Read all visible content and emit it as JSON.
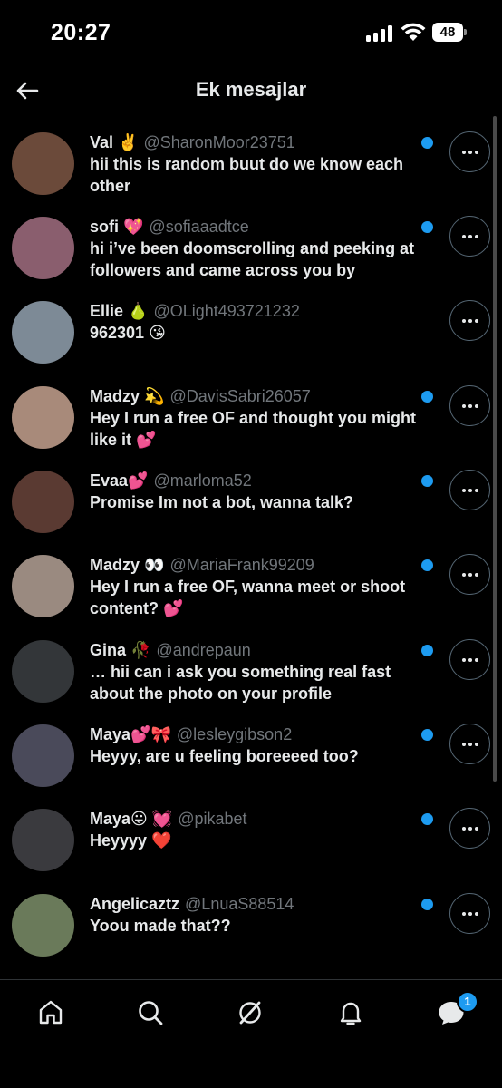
{
  "status_bar": {
    "time": "20:27",
    "battery": "48"
  },
  "header": {
    "title": "Ek mesajlar"
  },
  "conversations": [
    {
      "name": "Val ✌️",
      "handle": "@SharonMoor23751",
      "preview": "hii this is random buut do we know each other",
      "unread": true,
      "avatar_color": "#6b4a3a"
    },
    {
      "name": "sofi 💖",
      "handle": "@sofiaaadtce",
      "preview": "hi i’ve been doomscrolling and peeking at followers and came across you by",
      "unread": true,
      "avatar_color": "#8a5e6e"
    },
    {
      "name": "Ellie 🍐",
      "handle": "@OLight493721232",
      "preview": "962301 😘",
      "unread": false,
      "avatar_color": "#7d8a96"
    },
    {
      "name": "Madzy 💫",
      "handle": "@DavisSabri26057",
      "preview": "Hey I run a free OF and thought you might like it 💕",
      "unread": true,
      "avatar_color": "#a88a7a"
    },
    {
      "name": "Evaa💕",
      "handle": "@marloma52",
      "preview": "Promise Im not a bot, wanna talk?",
      "unread": true,
      "avatar_color": "#5a3a32"
    },
    {
      "name": "Madzy 👀",
      "handle": "@MariaFrank99209",
      "preview": "Hey I run a free OF, wanna meet or shoot content? 💕",
      "unread": true,
      "avatar_color": "#9a8a80"
    },
    {
      "name": "Gina 🥀",
      "handle": "@andrepaun",
      "preview": "… hii can i ask you something real fast about the photo on your profile",
      "unread": true,
      "avatar_color": "#333639"
    },
    {
      "name": "Maya💕🎀",
      "handle": "@lesleygibson2",
      "preview": "Heyyy, are u feeling boreeeed too?",
      "unread": true,
      "avatar_color": "#4a4a5a"
    },
    {
      "name": "Maya😛 💓",
      "handle": "@pikabet",
      "preview": "Heyyyy ❤️",
      "unread": true,
      "avatar_color": "#3a3a3e"
    },
    {
      "name": "Angelicaztz",
      "handle": "@LnuaS88514",
      "preview": "Yoou made that??",
      "unread": true,
      "avatar_color": "#6a7a5a"
    }
  ],
  "tabbar": {
    "messages_badge": "1"
  },
  "colors": {
    "accent": "#1d9bf0",
    "text": "#e7e9ea",
    "muted": "#71767b",
    "background": "#000000"
  }
}
